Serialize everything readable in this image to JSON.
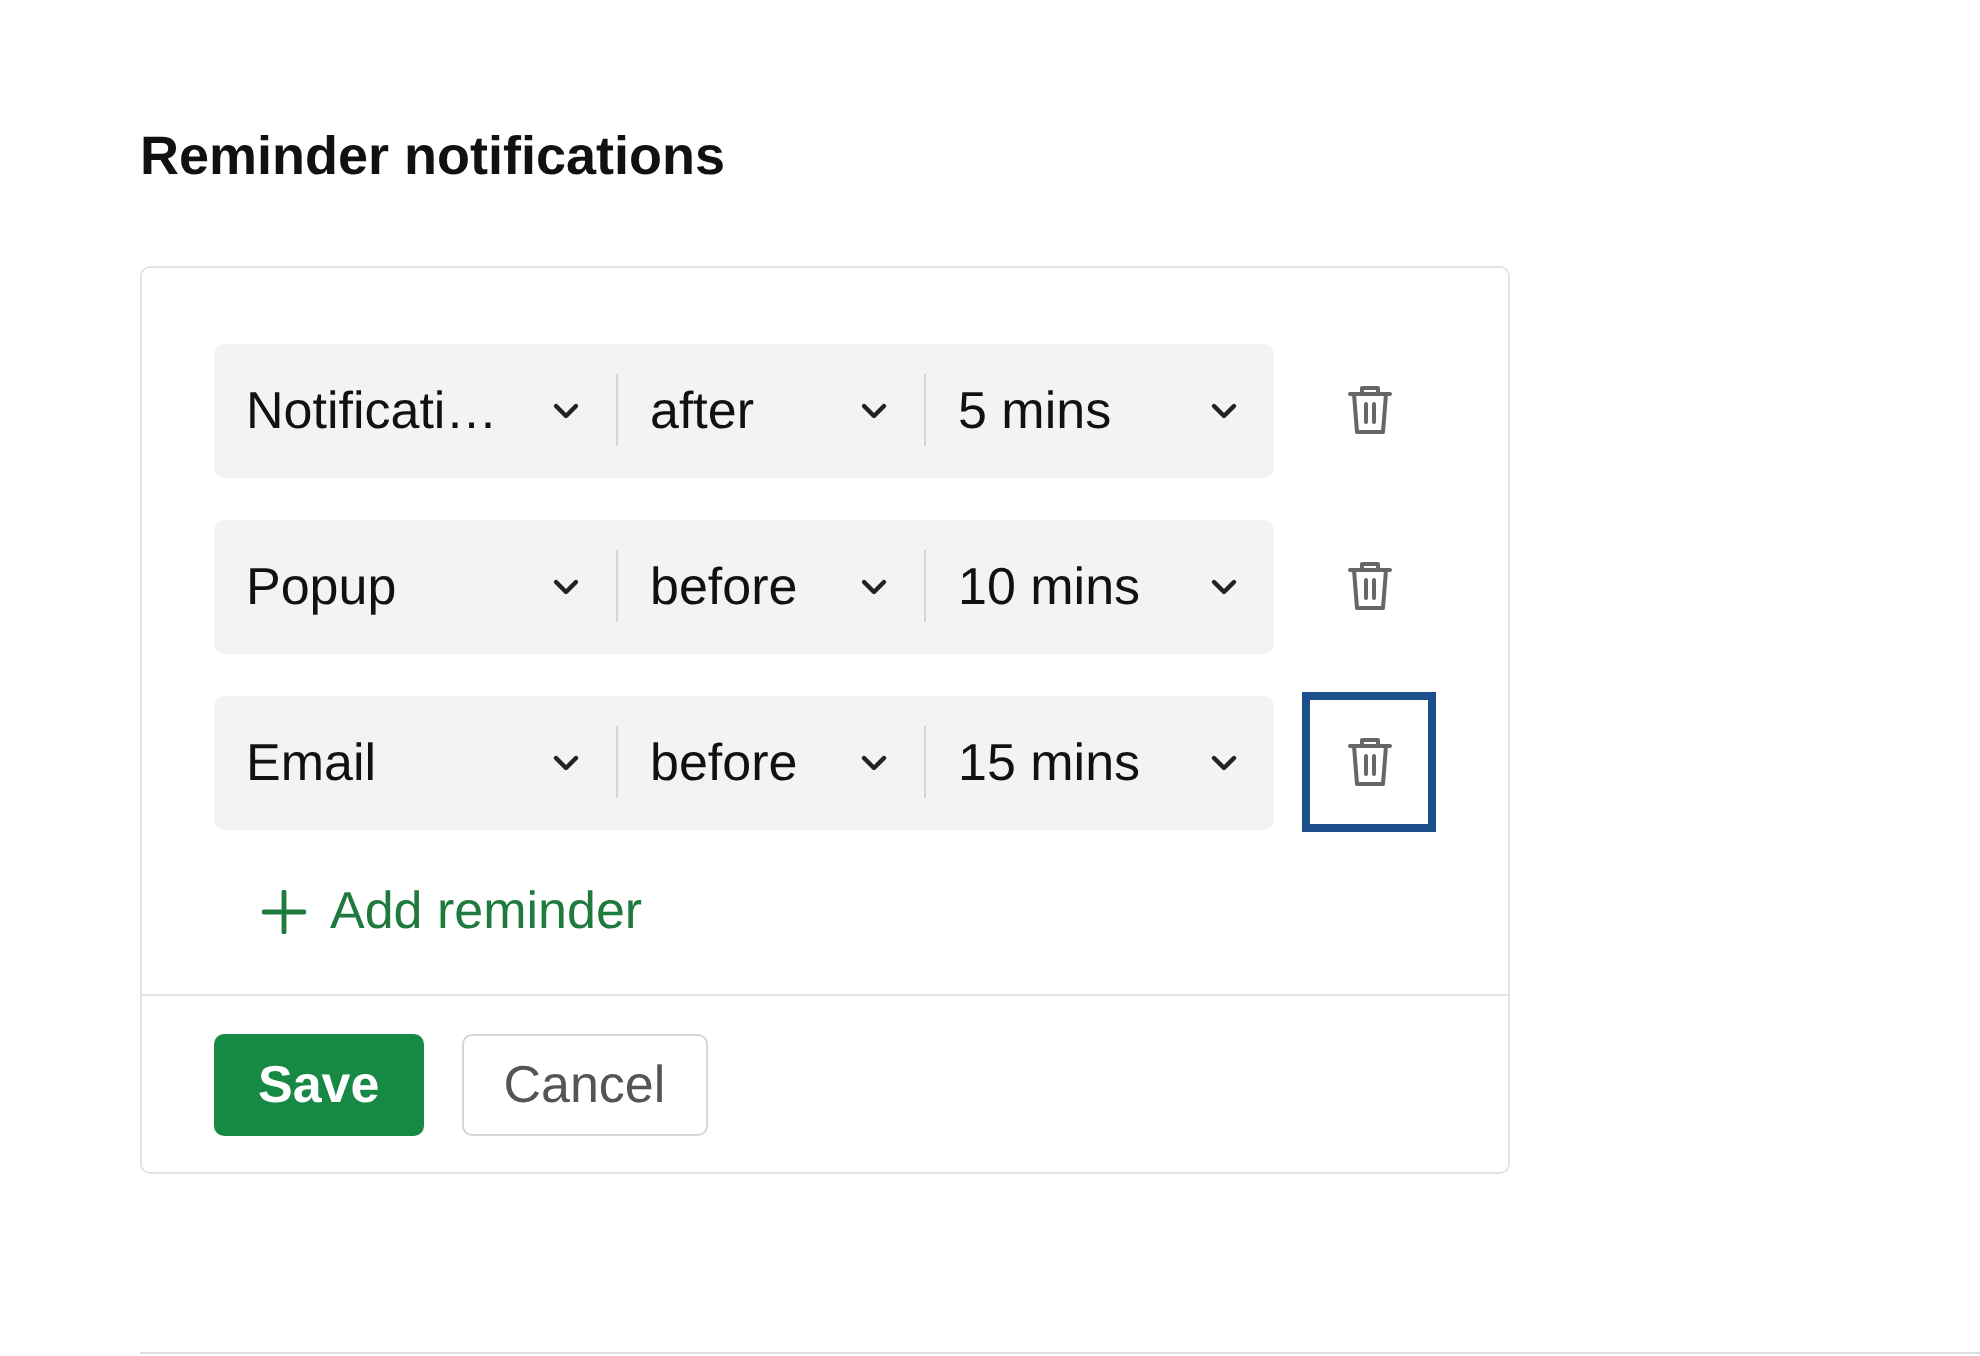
{
  "title": "Reminder notifications",
  "reminders": [
    {
      "type": "Notificati…",
      "timing": "after",
      "interval": "5 mins",
      "delete_focused": false
    },
    {
      "type": "Popup",
      "timing": "before",
      "interval": "10 mins",
      "delete_focused": false
    },
    {
      "type": "Email",
      "timing": "before",
      "interval": "15 mins",
      "delete_focused": true
    }
  ],
  "add_label": "Add reminder",
  "buttons": [
    {
      "label": "Save",
      "kind": "primary"
    },
    {
      "label": "Cancel",
      "kind": "secondary"
    }
  ]
}
